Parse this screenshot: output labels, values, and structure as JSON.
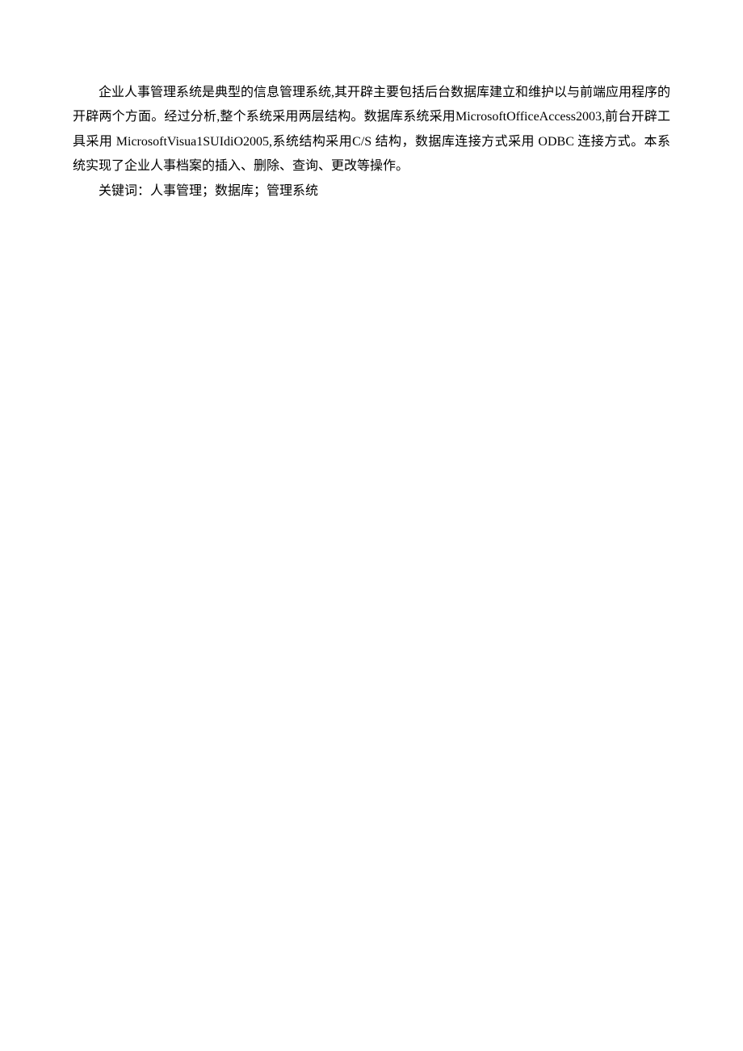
{
  "abstract": {
    "paragraph1": "企业人事管理系统是典型的信息管理系统,其开辟主要包括后台数据库建立和维护以与前端应用程序的开辟两个方面。经过分析,整个系统采用两层结构。数据库系统采用MicrosoftOfficeAccess2003,前台开辟工具采用 MicrosoftVisua1SUIdiO2005,系统结构采用C/S 结构，数据库连接方式采用 ODBC 连接方式。本系统实现了企业人事档案的插入、删除、查询、更改等操作。",
    "keywords_line": "关键词：人事管理；数据库；管理系统"
  }
}
